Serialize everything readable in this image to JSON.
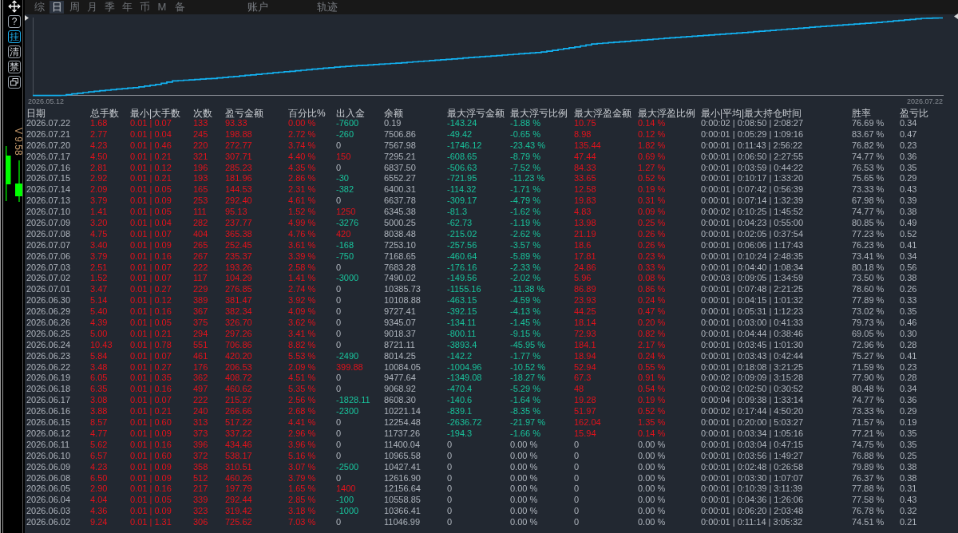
{
  "toolbar": [
    {
      "label": "?",
      "selected": false
    },
    {
      "label": "挂",
      "selected": true
    },
    {
      "label": "清",
      "selected": false
    },
    {
      "label": "禁",
      "selected": false
    }
  ],
  "version": "V 9.58",
  "tabs": [
    {
      "label": "综",
      "selected": false
    },
    {
      "label": "日",
      "selected": true
    },
    {
      "label": "周",
      "selected": false
    },
    {
      "label": "月",
      "selected": false
    },
    {
      "label": "季",
      "selected": false
    },
    {
      "label": "年",
      "selected": false
    },
    {
      "label": "币",
      "selected": false
    },
    {
      "label": "M",
      "selected": false
    },
    {
      "label": "备",
      "selected": false
    }
  ],
  "panels": [
    {
      "label": "账户",
      "selected": false
    },
    {
      "label": "轨迹",
      "selected": false
    }
  ],
  "chart": {
    "start_date": "2026.05.12",
    "end_date": "2026.07.22"
  },
  "table": {
    "columns": [
      {
        "label": "日期",
        "kind": "plain"
      },
      {
        "label": "总手数",
        "kind": "profit"
      },
      {
        "label": "最小|大手数",
        "kind": "profit"
      },
      {
        "label": "次数",
        "kind": "profit"
      },
      {
        "label": "盈亏金额",
        "kind": "profit"
      },
      {
        "label": "百分比%",
        "kind": "profit"
      },
      {
        "label": "出入金",
        "kind": "signed"
      },
      {
        "label": "余额",
        "kind": "plain"
      },
      {
        "label": "最大浮亏金额",
        "kind": "signed"
      },
      {
        "label": "最大浮亏比例",
        "kind": "signed"
      },
      {
        "label": "最大浮盈金额",
        "kind": "signed"
      },
      {
        "label": "最大浮盈比例",
        "kind": "signed"
      },
      {
        "label": "最小|平均|最大持仓时间",
        "kind": "plain"
      },
      {
        "label": "胜率",
        "kind": "plain"
      },
      {
        "label": "盈亏比",
        "kind": "plain"
      }
    ],
    "rows": [
      [
        "2026.07.22",
        "1.68",
        "0.01 | 0.07",
        "133",
        "93.33",
        "0.00 %",
        "-7600",
        "0.19",
        "-143.24",
        "-1.88 %",
        "10.75",
        "0.14 %",
        "0:00:02 | 0:08:50 | 2:08:27",
        "76.69 %",
        "0.34"
      ],
      [
        "2026.07.21",
        "2.77",
        "0.01 | 0.04",
        "245",
        "198.88",
        "2.72 %",
        "-260",
        "7506.86",
        "-49.42",
        "-0.65 %",
        "8.98",
        "0.12 %",
        "0:00:01 | 0:05:29 | 1:09:16",
        "83.67 %",
        "0.47"
      ],
      [
        "2026.07.20",
        "4.23",
        "0.01 | 0.46",
        "220",
        "272.77",
        "3.74 %",
        "0",
        "7567.98",
        "-1746.12",
        "-23.43 %",
        "135.44",
        "1.82 %",
        "0:00:01 | 0:11:43 | 2:56:22",
        "76.82 %",
        "0.23"
      ],
      [
        "2026.07.17",
        "4.50",
        "0.01 | 0.21",
        "321",
        "307.71",
        "4.40 %",
        "150",
        "7295.21",
        "-608.65",
        "-8.79 %",
        "47.44",
        "0.69 %",
        "0:00:01 | 0:06:50 | 2:27:55",
        "74.77 %",
        "0.36"
      ],
      [
        "2026.07.16",
        "2.81",
        "0.01 | 0.12",
        "196",
        "285.23",
        "4.35 %",
        "0",
        "6837.50",
        "-506.63",
        "-7.52 %",
        "84.33",
        "1.27 %",
        "0:00:01 | 0:03:59 | 0:44:22",
        "76.53 %",
        "0.35"
      ],
      [
        "2026.07.15",
        "2.92",
        "0.01 | 0.21",
        "193",
        "181.96",
        "2.86 %",
        "-30",
        "6552.27",
        "-721.95",
        "-11.23 %",
        "33.65",
        "0.52 %",
        "0:00:01 | 0:10:17 | 1:33:20",
        "75.65 %",
        "0.29"
      ],
      [
        "2026.07.14",
        "2.09",
        "0.01 | 0.05",
        "165",
        "144.53",
        "2.31 %",
        "-382",
        "6400.31",
        "-114.32",
        "-1.71 %",
        "12.58",
        "0.19 %",
        "0:00:01 | 0:07:42 | 0:56:39",
        "73.33 %",
        "0.43"
      ],
      [
        "2026.07.13",
        "3.79",
        "0.01 | 0.09",
        "253",
        "292.40",
        "4.61 %",
        "0",
        "6637.78",
        "-309.17",
        "-4.79 %",
        "19.83",
        "0.31 %",
        "0:00:01 | 0:07:14 | 1:32:39",
        "67.98 %",
        "0.39"
      ],
      [
        "2026.07.10",
        "1.41",
        "0.01 | 0.05",
        "111",
        "95.13",
        "1.52 %",
        "1250",
        "6345.38",
        "-81.3",
        "-1.62 %",
        "4.83",
        "0.09 %",
        "0:00:02 | 0:10:25 | 1:45:52",
        "74.77 %",
        "0.38"
      ],
      [
        "2026.07.09",
        "3.20",
        "0.01 | 0.04",
        "282",
        "237.77",
        "4.99 %",
        "-3276",
        "5000.25",
        "-62.73",
        "-1.19 %",
        "13.98",
        "0.25 %",
        "0:00:01 | 0:04:23 | 0:55:00",
        "80.85 %",
        "0.49"
      ],
      [
        "2026.07.08",
        "4.75",
        "0.01 | 0.07",
        "404",
        "365.38",
        "4.76 %",
        "420",
        "8038.48",
        "-215.02",
        "-2.62 %",
        "21.19",
        "0.26 %",
        "0:00:01 | 0:02:05 | 0:37:54",
        "77.23 %",
        "0.52"
      ],
      [
        "2026.07.07",
        "3.40",
        "0.01 | 0.09",
        "265",
        "252.45",
        "3.61 %",
        "-168",
        "7253.10",
        "-257.56",
        "-3.57 %",
        "18.6",
        "0.26 %",
        "0:00:01 | 0:06:06 | 1:17:43",
        "76.23 %",
        "0.41"
      ],
      [
        "2026.07.06",
        "3.79",
        "0.01 | 0.16",
        "267",
        "235.37",
        "3.39 %",
        "-750",
        "7168.65",
        "-460.64",
        "-5.89 %",
        "17.81",
        "0.23 %",
        "0:00:01 | 0:10:24 | 2:48:35",
        "73.41 %",
        "0.34"
      ],
      [
        "2026.07.03",
        "2.51",
        "0.01 | 0.07",
        "222",
        "193.26",
        "2.58 %",
        "0",
        "7683.28",
        "-176.16",
        "-2.33 %",
        "24.86",
        "0.33 %",
        "0:00:01 | 0:04:40 | 1:08:34",
        "80.18 %",
        "0.56"
      ],
      [
        "2026.07.02",
        "1.52",
        "0.01 | 0.07",
        "117",
        "104.29",
        "1.41 %",
        "-3000",
        "7490.02",
        "-149.56",
        "-2.02 %",
        "5.96",
        "0.08 %",
        "0:00:03 | 0:09:05 | 1:34:59",
        "73.50 %",
        "0.38"
      ],
      [
        "2026.07.01",
        "3.47",
        "0.01 | 0.27",
        "229",
        "276.85",
        "2.74 %",
        "0",
        "10385.73",
        "-1155.16",
        "-11.38 %",
        "86.89",
        "0.86 %",
        "0:00:01 | 0:07:48 | 2:21:25",
        "78.60 %",
        "0.26"
      ],
      [
        "2026.06.30",
        "5.14",
        "0.01 | 0.12",
        "389",
        "381.47",
        "3.92 %",
        "0",
        "10108.88",
        "-463.15",
        "-4.59 %",
        "23.93",
        "0.24 %",
        "0:00:01 | 0:04:15 | 1:01:32",
        "77.89 %",
        "0.33"
      ],
      [
        "2026.06.29",
        "5.40",
        "0.01 | 0.16",
        "367",
        "382.34",
        "4.09 %",
        "0",
        "9727.41",
        "-392.15",
        "-4.13 %",
        "44.25",
        "0.47 %",
        "0:00:01 | 0:05:31 | 1:12:23",
        "73.02 %",
        "0.35"
      ],
      [
        "2026.06.26",
        "4.39",
        "0.01 | 0.05",
        "375",
        "326.70",
        "3.62 %",
        "0",
        "9345.07",
        "-134.11",
        "-1.45 %",
        "18.14",
        "0.20 %",
        "0:00:01 | 0:03:00 | 0:41:33",
        "79.73 %",
        "0.46"
      ],
      [
        "2026.06.25",
        "5.00",
        "0.01 | 0.21",
        "294",
        "297.26",
        "3.41 %",
        "0",
        "9018.37",
        "-800.11",
        "-9.15 %",
        "72.93",
        "0.82 %",
        "0:00:01 | 0:04:44 | 0:38:46",
        "69.05 %",
        "0.30"
      ],
      [
        "2026.06.24",
        "10.43",
        "0.01 | 0.78",
        "551",
        "706.86",
        "8.82 %",
        "0",
        "8721.11",
        "-3893.4",
        "-45.95 %",
        "184.1",
        "2.17 %",
        "0:00:01 | 0:03:45 | 1:01:30",
        "72.96 %",
        "0.28"
      ],
      [
        "2026.06.23",
        "5.84",
        "0.01 | 0.07",
        "461",
        "420.20",
        "5.53 %",
        "-2490",
        "8014.25",
        "-142.2",
        "-1.77 %",
        "18.94",
        "0.24 %",
        "0:00:01 | 0:03:43 | 0:42:44",
        "75.27 %",
        "0.41"
      ],
      [
        "2026.06.22",
        "3.48",
        "0.01 | 0.27",
        "176",
        "206.53",
        "2.09 %",
        "399.88",
        "10084.05",
        "-1004.96",
        "-10.52 %",
        "52.94",
        "0.55 %",
        "0:00:01 | 0:18:08 | 3:21:25",
        "71.59 %",
        "0.23"
      ],
      [
        "2026.06.19",
        "6.05",
        "0.01 | 0.35",
        "362",
        "408.72",
        "4.51 %",
        "0",
        "9477.64",
        "-1349.08",
        "-18.27 %",
        "67.3",
        "0.91 %",
        "0:00:02 | 0:09:09 | 3:15:28",
        "77.90 %",
        "0.28"
      ],
      [
        "2026.06.18",
        "6.35",
        "0.01 | 0.16",
        "497",
        "460.62",
        "5.35 %",
        "0",
        "9068.92",
        "-470.4",
        "-5.29 %",
        "48",
        "0.54 %",
        "0:00:02 | 0:02:50 | 0:30:52",
        "80.48 %",
        "0.34"
      ],
      [
        "2026.06.17",
        "3.08",
        "0.01 | 0.07",
        "222",
        "215.27",
        "2.56 %",
        "-1828.11",
        "8608.30",
        "-140.6",
        "-1.64 %",
        "19.28",
        "0.19 %",
        "0:00:04 | 0:09:38 | 1:33:14",
        "74.77 %",
        "0.36"
      ],
      [
        "2026.06.16",
        "3.88",
        "0.01 | 0.21",
        "240",
        "266.66",
        "2.68 %",
        "-2300",
        "10221.14",
        "-839.1",
        "-8.35 %",
        "51.97",
        "0.52 %",
        "0:00:02 | 0:17:44 | 4:50:20",
        "73.33 %",
        "0.29"
      ],
      [
        "2026.06.15",
        "8.57",
        "0.01 | 0.60",
        "313",
        "517.22",
        "4.41 %",
        "0",
        "12254.48",
        "-2636.72",
        "-21.97 %",
        "162.04",
        "1.35 %",
        "0:00:01 | 0:20:00 | 5:03:27",
        "71.57 %",
        "0.19"
      ],
      [
        "2026.06.12",
        "4.77",
        "0.01 | 0.09",
        "373",
        "337.22",
        "2.96 %",
        "0",
        "11737.26",
        "-194.3",
        "-1.66 %",
        "15.94",
        "0.14 %",
        "0:00:01 | 0:03:34 | 1:05:16",
        "77.21 %",
        "0.35"
      ],
      [
        "2026.06.11",
        "5.62",
        "0.01 | 0.16",
        "396",
        "434.46",
        "3.96 %",
        "0",
        "11400.04",
        "0",
        "0.00 %",
        "0",
        "0.00 %",
        "0:00:01 | 0:03:04 | 0:47:15",
        "74.75 %",
        "0.35"
      ],
      [
        "2026.06.10",
        "6.57",
        "0.01 | 0.60",
        "372",
        "538.17",
        "5.16 %",
        "0",
        "10965.58",
        "0",
        "0.00 %",
        "0",
        "0.00 %",
        "0:00:01 | 0:03:56 | 1:49:27",
        "76.88 %",
        "0.25"
      ],
      [
        "2026.06.09",
        "4.23",
        "0.01 | 0.09",
        "358",
        "310.51",
        "3.07 %",
        "-2500",
        "10427.41",
        "0",
        "0.00 %",
        "0",
        "0.00 %",
        "0:00:01 | 0:02:48 | 0:26:58",
        "79.89 %",
        "0.38"
      ],
      [
        "2026.06.08",
        "6.50",
        "0.01 | 0.09",
        "512",
        "460.26",
        "3.79 %",
        "0",
        "12616.90",
        "0",
        "0.00 %",
        "0",
        "0.00 %",
        "0:00:01 | 0:03:30 | 1:07:07",
        "76.37 %",
        "0.38"
      ],
      [
        "2026.06.05",
        "2.90",
        "0.01 | 0.16",
        "217",
        "197.79",
        "1.65 %",
        "1400",
        "12156.64",
        "0",
        "0.00 %",
        "0",
        "0.00 %",
        "0:00:01 | 0:10:39 | 3:11:39",
        "77.88 %",
        "0.31"
      ],
      [
        "2026.06.04",
        "4.04",
        "0.01 | 0.05",
        "339",
        "292.44",
        "2.85 %",
        "-100",
        "10558.85",
        "0",
        "0.00 %",
        "0",
        "0.00 %",
        "0:00:01 | 0:04:36 | 1:26:06",
        "77.58 %",
        "0.43"
      ],
      [
        "2026.06.03",
        "4.36",
        "0.01 | 0.09",
        "323",
        "319.42",
        "3.18 %",
        "-1000",
        "10366.41",
        "0",
        "0.00 %",
        "0",
        "0.00 %",
        "0:00:01 | 0:06:20 | 2:03:48",
        "76.78 %",
        "0.32"
      ],
      [
        "2026.06.02",
        "9.24",
        "0.01 | 1.31",
        "306",
        "725.62",
        "7.03 %",
        "0",
        "11046.99",
        "0",
        "0.00 %",
        "0",
        "0.00 %",
        "0:00:01 | 0:11:14 | 3:05:32",
        "74.51 %",
        "0.21"
      ]
    ]
  }
}
